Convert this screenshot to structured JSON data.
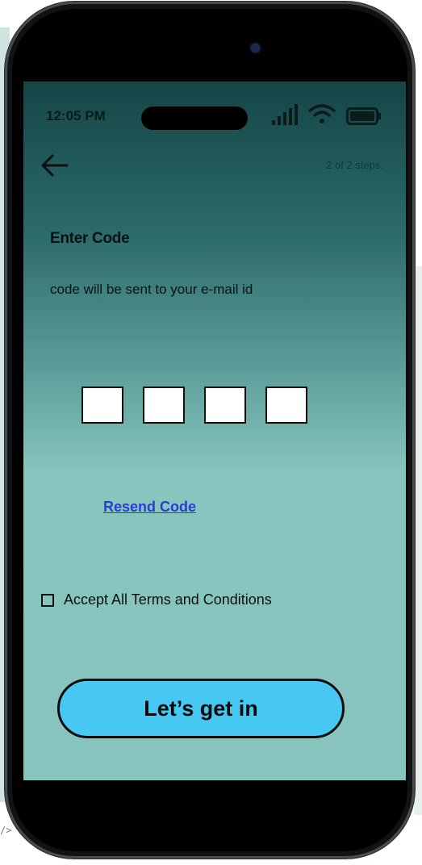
{
  "status_bar": {
    "time": "12:05 PM"
  },
  "header": {
    "back_icon": "arrow-left-icon",
    "steps_text": "2 of 2 steps."
  },
  "content": {
    "title": "Enter Code",
    "subtitle": "code will be sent to your e-mail id",
    "code_digits": [
      "",
      "",
      "",
      ""
    ],
    "resend_label": "Resend Code",
    "terms_label": "Accept All Terms and Conditions",
    "terms_checked": false,
    "cta_label": "Let’s get in"
  },
  "background": {
    "editor_tag": "/>"
  },
  "colors": {
    "accent_button": "#46c8f2",
    "link": "#2c3dd6",
    "gradient_top": "#154546",
    "gradient_bottom": "#88c4be"
  }
}
